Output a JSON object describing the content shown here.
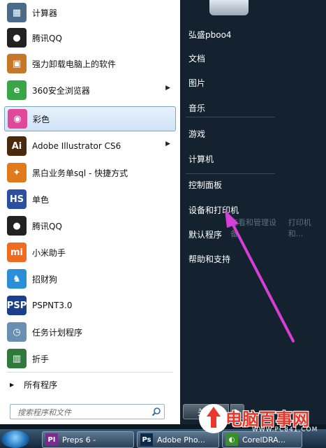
{
  "left_menu": {
    "items": [
      {
        "label": "计算器",
        "icon": "calculator-icon",
        "color": "#4a6b8a",
        "glyph": "▦",
        "submenu": false,
        "selected": false
      },
      {
        "label": "腾讯QQ",
        "icon": "qq-penguin-icon",
        "color": "#222222",
        "glyph": "●",
        "submenu": false,
        "selected": false
      },
      {
        "label": "强力卸载电脑上的软件",
        "icon": "uninstall-box-icon",
        "color": "#c8772a",
        "glyph": "▣",
        "submenu": false,
        "selected": false
      },
      {
        "label": "360安全浏览器",
        "icon": "360-browser-icon",
        "color": "#38a546",
        "glyph": "e",
        "submenu": true,
        "selected": false
      },
      {
        "label": "彩色",
        "icon": "color-print-icon",
        "color": "#e0489a",
        "glyph": "◉",
        "submenu": false,
        "selected": true
      },
      {
        "label": "Adobe Illustrator CS6",
        "icon": "illustrator-icon",
        "color": "#4a2a0a",
        "glyph": "Ai",
        "submenu": true,
        "selected": false
      },
      {
        "label": "黑白业务单sql - 快捷方式",
        "icon": "squirrel-icon",
        "color": "#e07a1a",
        "glyph": "✦",
        "submenu": false,
        "selected": false
      },
      {
        "label": "单色",
        "icon": "hs-logo-icon",
        "color": "#2c4fa0",
        "glyph": "HS",
        "submenu": false,
        "selected": false
      },
      {
        "label": "腾讯QQ",
        "icon": "qq-penguin-icon",
        "color": "#222222",
        "glyph": "●",
        "submenu": false,
        "selected": false
      },
      {
        "label": "小米助手",
        "icon": "xiaomi-icon",
        "color": "#f06b1f",
        "glyph": "mi",
        "submenu": false,
        "selected": false
      },
      {
        "label": "招财狗",
        "icon": "dog-icon",
        "color": "#2a8fd6",
        "glyph": "♞",
        "submenu": false,
        "selected": false
      },
      {
        "label": "PSPNT3.0",
        "icon": "pspnt-icon",
        "color": "#1b3f8a",
        "glyph": "PSP",
        "submenu": false,
        "selected": false
      },
      {
        "label": "任务计划程序",
        "icon": "clock-icon",
        "color": "#6b8fb0",
        "glyph": "◷",
        "submenu": false,
        "selected": false
      },
      {
        "label": "折手",
        "icon": "books-icon",
        "color": "#2f7a3a",
        "glyph": "▥",
        "submenu": false,
        "selected": false
      }
    ],
    "all_programs": "所有程序",
    "search_placeholder": "搜索程序和文件"
  },
  "right_menu": {
    "username": "弘盛pboo4",
    "items": [
      "文档",
      "图片",
      "音乐",
      "游戏",
      "计算机",
      "控制面板",
      "设备和打印机",
      "默认程序",
      "帮助和支持"
    ],
    "shutdown_label": "关机"
  },
  "tooltip_ghost": [
    "查看和管理设备",
    "打印机和..."
  ],
  "taskbar": {
    "tasks": [
      {
        "label": "Preps 6 -",
        "icon": "preps-icon",
        "glyph": "PI",
        "color": "#7b2a8f"
      },
      {
        "label": "Adobe Pho...",
        "icon": "photoshop-icon",
        "glyph": "Ps",
        "color": "#0b2a4a"
      },
      {
        "label": "CorelDRA...",
        "icon": "coreldraw-icon",
        "glyph": "◐",
        "color": "#3a8f2a"
      }
    ]
  },
  "watermark": {
    "text": "电脑百事网",
    "url": "WWW.PC841.COM"
  },
  "colors": {
    "accent": "#d63fd6",
    "menu_bg": "#ffffff",
    "right_bg": "#13222e"
  }
}
